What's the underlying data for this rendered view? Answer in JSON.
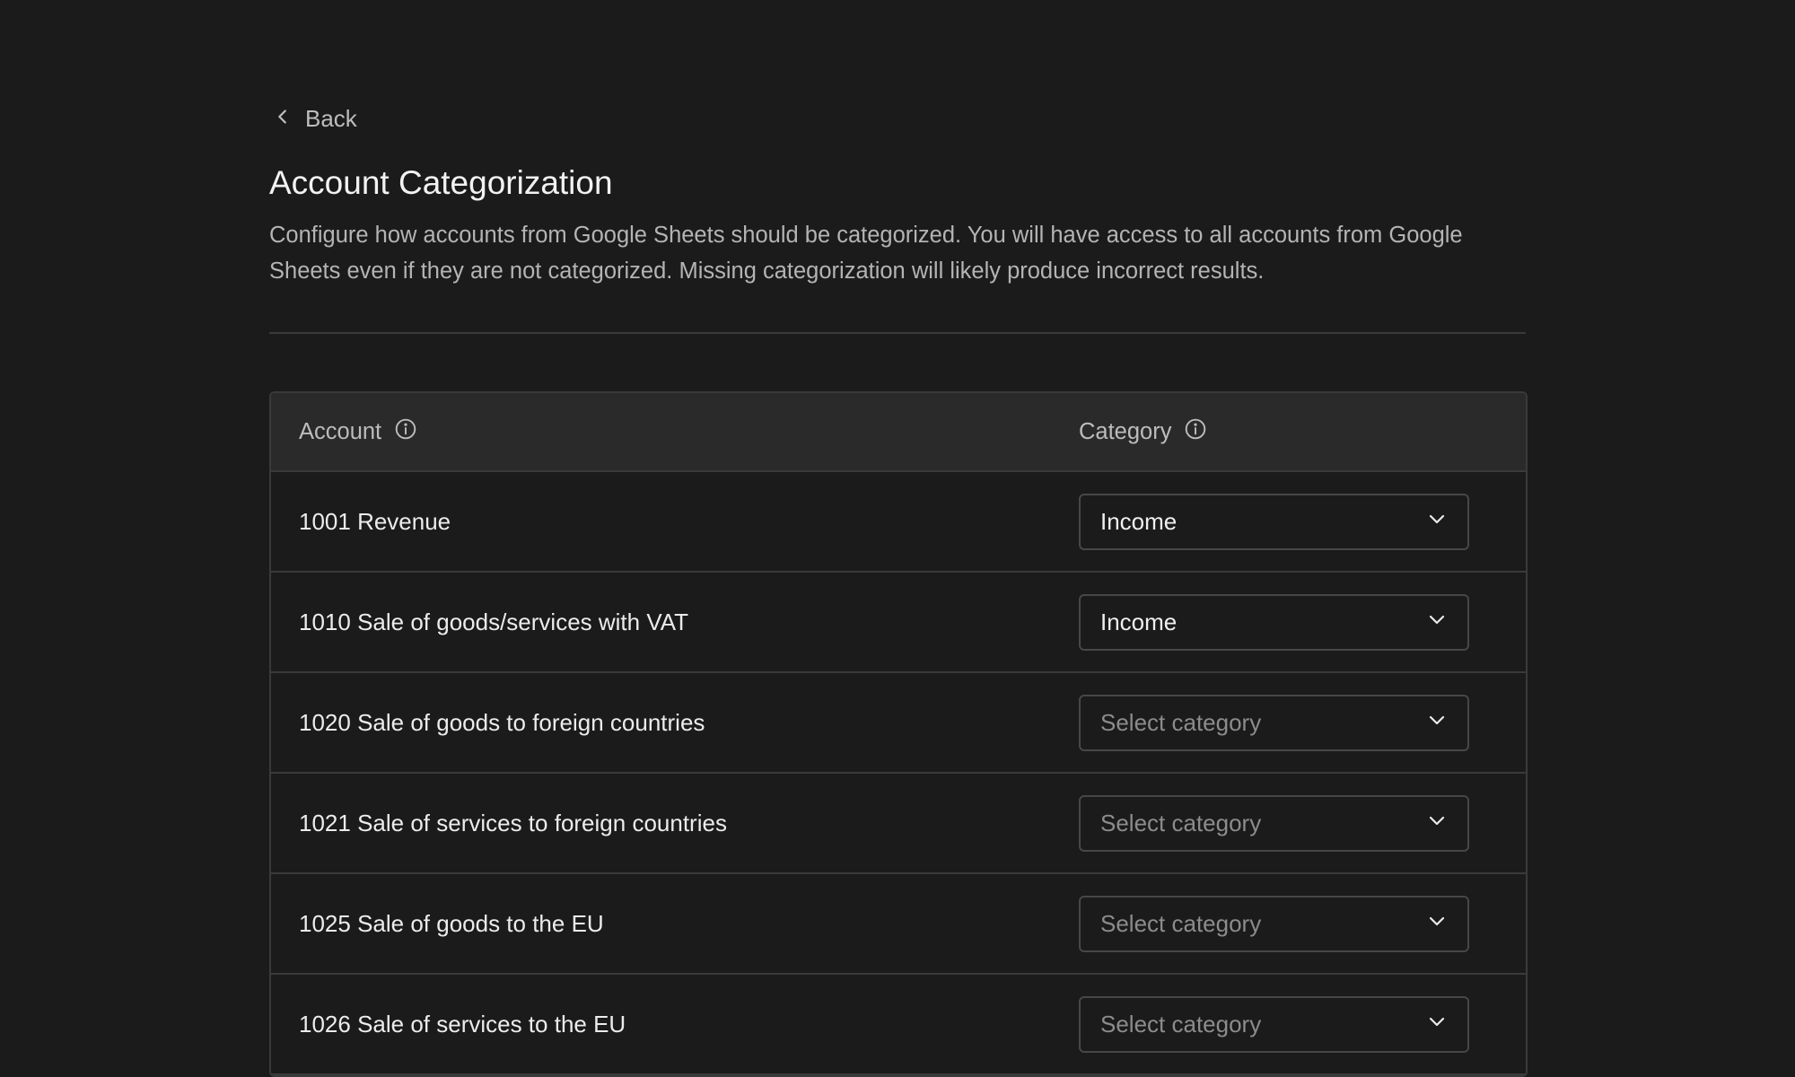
{
  "nav": {
    "back_label": "Back"
  },
  "header": {
    "title": "Account Categorization",
    "description": "Configure how accounts from Google Sheets should be categorized. You will have access to all accounts from Google Sheets even if they are not categorized. Missing categorization will likely produce incorrect results."
  },
  "table": {
    "columns": {
      "account": "Account",
      "category": "Category"
    },
    "rows": [
      {
        "account": "1001 Revenue",
        "category": "Income",
        "state": "filled"
      },
      {
        "account": "1010 Sale of goods/services with VAT",
        "category": "Income",
        "state": "filled"
      },
      {
        "account": "1020 Sale of goods to foreign countries",
        "category": "Select category",
        "state": "empty"
      },
      {
        "account": "1021 Sale of services to foreign countries",
        "category": "Select category",
        "state": "empty"
      },
      {
        "account": "1025 Sale of goods to the EU",
        "category": "Select category",
        "state": "empty"
      },
      {
        "account": "1026 Sale of services to the EU",
        "category": "Select category",
        "state": "empty"
      }
    ]
  },
  "icons": {
    "back": "chevron-left-icon",
    "info": "info-icon",
    "dropdown": "chevron-down-icon"
  },
  "colors": {
    "background": "#1b1b1b",
    "header_row": "#2a2a2a",
    "border": "#3a3a3a",
    "placeholder": "#8c8c8c"
  }
}
